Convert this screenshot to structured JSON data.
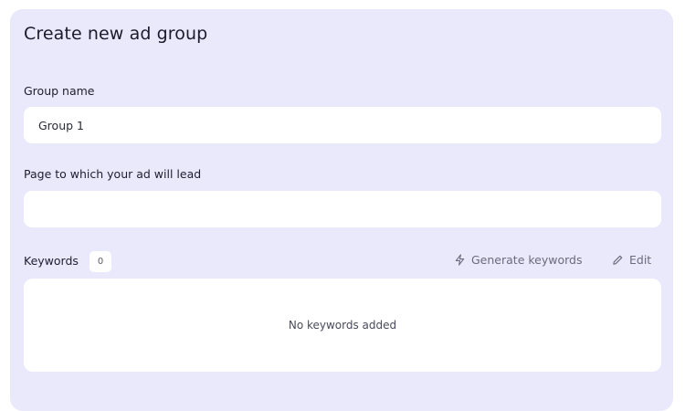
{
  "form": {
    "title": "Create new ad group",
    "group_name": {
      "label": "Group name",
      "value": "Group 1"
    },
    "landing_page": {
      "label": "Page to which your ad will lead",
      "value": ""
    },
    "keywords": {
      "label": "Keywords",
      "count": "0",
      "generate_label": "Generate keywords",
      "edit_label": "Edit",
      "empty_text": "No keywords added"
    }
  },
  "icons": {
    "generate": "lightning-icon",
    "edit": "pencil-icon"
  },
  "colors": {
    "panel_bg": "#eae8fb",
    "field_bg": "#ffffff",
    "muted_text": "#6b6b7e"
  }
}
